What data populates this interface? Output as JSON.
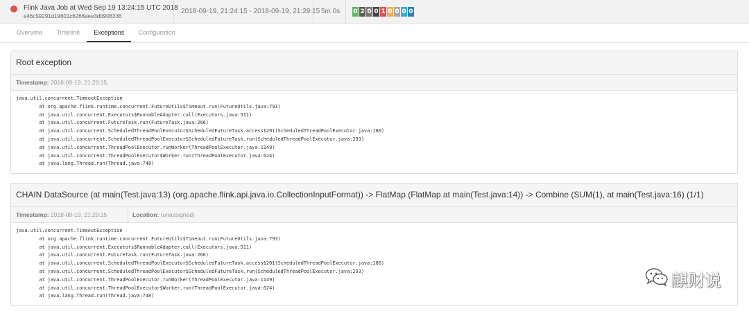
{
  "header": {
    "job_name": "Flink Java Job at Wed Sep 19 13:24:15 UTC 2018",
    "job_id": "e46c59291d19601c6268aee3db908336",
    "time_range": "2018-09-19, 21:24:15 - 2018-09-19, 21:29:15",
    "duration": "5m 0s",
    "status_color": "#d9534f",
    "task_counts": [
      {
        "value": "0",
        "color": "#5cb85c"
      },
      {
        "value": "2",
        "color": "#5a5a5a"
      },
      {
        "value": "0",
        "color": "#777777"
      },
      {
        "value": "0",
        "color": "#444444"
      },
      {
        "value": "1",
        "color": "#d9534f"
      },
      {
        "value": "0",
        "color": "#f0ad4e"
      },
      {
        "value": "0",
        "color": "#aaaaaa"
      },
      {
        "value": "0",
        "color": "#31b0d5"
      },
      {
        "value": "0",
        "color": "#337ab7"
      }
    ]
  },
  "tabs": [
    {
      "label": "Overview"
    },
    {
      "label": "Timeline"
    },
    {
      "label": "Exceptions",
      "active": true
    },
    {
      "label": "Configuration"
    }
  ],
  "root_exception": {
    "title": "Root exception",
    "timestamp_label": "Timestamp:",
    "timestamp": "2018-09-19, 21:29:15",
    "trace": [
      "java.util.concurrent.TimeoutException",
      "        at org.apache.flink.runtime.concurrent.FutureUtils$Timeout.run(FutureUtils.java:793)",
      "        at java.util.concurrent.Executors$RunnableAdapter.call(Executors.java:511)",
      "        at java.util.concurrent.FutureTask.run(FutureTask.java:266)",
      "        at java.util.concurrent.ScheduledThreadPoolExecutor$ScheduledFutureTask.access$201(ScheduledThreadPoolExecutor.java:180)",
      "        at java.util.concurrent.ScheduledThreadPoolExecutor$ScheduledFutureTask.run(ScheduledThreadPoolExecutor.java:293)",
      "        at java.util.concurrent.ThreadPoolExecutor.runWorker(ThreadPoolExecutor.java:1149)",
      "        at java.util.concurrent.ThreadPoolExecutor$Worker.run(ThreadPoolExecutor.java:624)",
      "        at java.lang.Thread.run(Thread.java:748)"
    ]
  },
  "task_exception": {
    "title": "CHAIN DataSource (at main(Test.java:13) (org.apache.flink.api.java.io.CollectionInputFormat)) -> FlatMap (FlatMap at main(Test.java:14)) -> Combine (SUM(1), at main(Test.java:16) (1/1)",
    "timestamp_label": "Timestamp:",
    "timestamp": "2018-09-19, 21:29:15",
    "location_label": "Location:",
    "location": "(unassigned)",
    "trace": [
      "java.util.concurrent.TimeoutException",
      "        at org.apache.flink.runtime.concurrent.FutureUtils$Timeout.run(FutureUtils.java:793)",
      "        at java.util.concurrent.Executors$RunnableAdapter.call(Executors.java:511)",
      "        at java.util.concurrent.FutureTask.run(FutureTask.java:266)",
      "        at java.util.concurrent.ScheduledThreadPoolExecutor$ScheduledFutureTask.access$201(ScheduledThreadPoolExecutor.java:180)",
      "        at java.util.concurrent.ScheduledThreadPoolExecutor$ScheduledFutureTask.run(ScheduledThreadPoolExecutor.java:293)",
      "        at java.util.concurrent.ThreadPoolExecutor.runWorker(ThreadPoolExecutor.java:1149)",
      "        at java.util.concurrent.ThreadPoolExecutor$Worker.run(ThreadPoolExecutor.java:624)",
      "        at java.lang.Thread.run(Thread.java:748)"
    ]
  },
  "watermark": {
    "icon": "wechat-icon",
    "text": "麒财说"
  }
}
